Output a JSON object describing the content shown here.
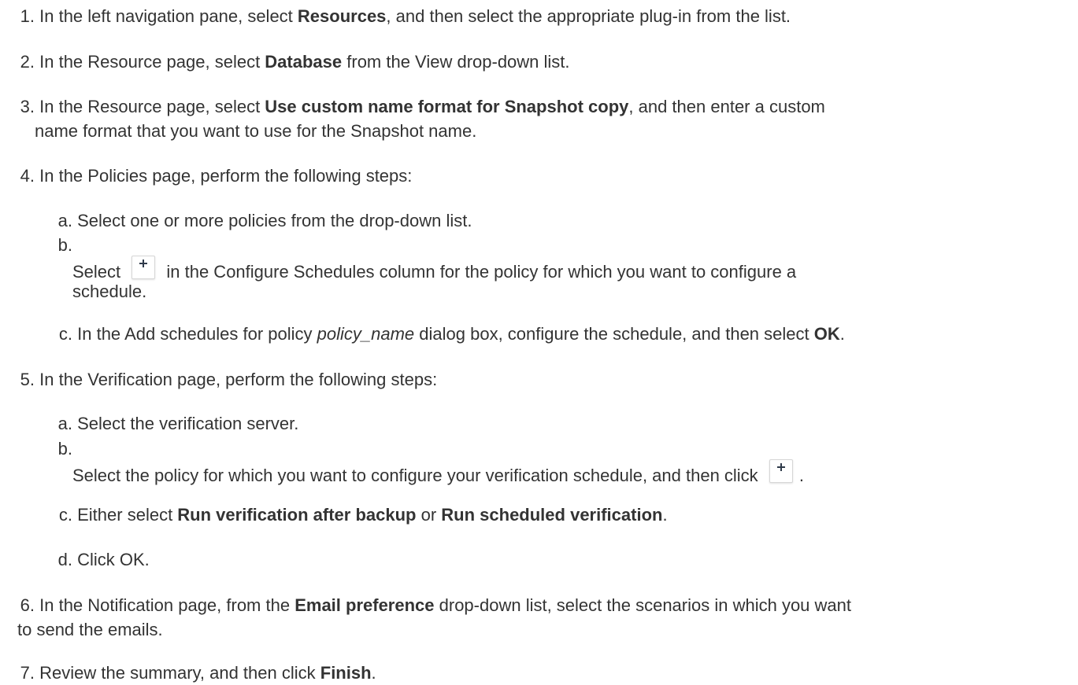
{
  "steps": {
    "s1": {
      "num": "1.",
      "t1": "In the left navigation pane, select ",
      "b1": "Resources",
      "t2": ", and then select the appropriate plug-in from the list."
    },
    "s2": {
      "num": "2.",
      "t1": "In the Resource page, select ",
      "b1": "Database",
      "t2": " from the View drop-down list."
    },
    "s3": {
      "num": "3.",
      "t1": "In the Resource page, select ",
      "b1": "Use custom name format for Snapshot copy",
      "t2": ", and then enter a custom",
      "line2": "name format that you want to use for the Snapshot name."
    },
    "s4": {
      "num": "4.",
      "t1": "In the Policies page, perform the following steps:",
      "a": {
        "letter": "a.",
        "t1": "Select one or more policies from the drop-down list."
      },
      "b": {
        "letter": "b.",
        "t1": "Select ",
        "t2": " in the Configure Schedules column for the policy for which you want to configure a",
        "line2": "schedule."
      },
      "c": {
        "letter": "c.",
        "t1": "In the Add schedules for policy ",
        "i1": "policy_name",
        "t2": " dialog box, configure the schedule, and then select ",
        "b1": "OK",
        "t3": "."
      }
    },
    "s5": {
      "num": "5.",
      "t1": "In the Verification page, perform the following steps:",
      "a": {
        "letter": "a.",
        "t1": "Select the verification server."
      },
      "b": {
        "letter": "b.",
        "t1": "Select the policy for which you want to configure your verification schedule, and then click ",
        "t2": "."
      },
      "c": {
        "letter": "c.",
        "t1": "Either select ",
        "b1": "Run verification after backup",
        "t2": " or ",
        "b2": "Run scheduled verification",
        "t3": "."
      },
      "d": {
        "letter": "d.",
        "t1": "Click OK."
      }
    },
    "s6": {
      "num": "6.",
      "t1": "In the Notification page, from the ",
      "b1": "Email preference",
      "t2": " drop-down list, select the scenarios in which you want",
      "line2": "to send the emails."
    },
    "s7": {
      "num": "7.",
      "t1": "Review the summary, and then click ",
      "b1": "Finish",
      "t2": "."
    }
  },
  "icons": {
    "add": "plus-icon"
  },
  "colors": {
    "text": "#333333",
    "plus": "#2f3a4a",
    "button_border": "#d6d6d6"
  }
}
